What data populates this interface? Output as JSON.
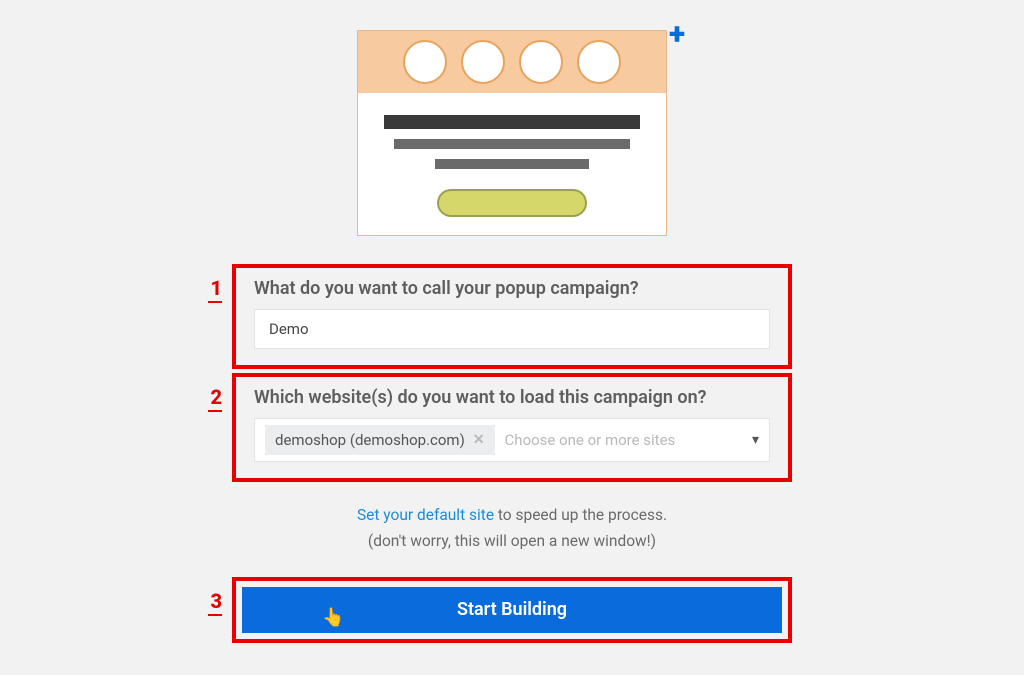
{
  "markers": {
    "one": "1",
    "two": "2",
    "three": "3"
  },
  "question1": {
    "label": "What do you want to call your popup campaign?",
    "value": "Demo"
  },
  "question2": {
    "label": "Which website(s) do you want to load this campaign on?",
    "chip": "demoshop (demoshop.com)",
    "placeholder": "Choose one or more sites"
  },
  "helper": {
    "link": "Set your default site",
    "text_after_link": " to speed up the process.",
    "sub": "(don't worry, this will open a new window!)"
  },
  "cta": {
    "label": "Start Building"
  },
  "icons": {
    "plus": "+",
    "chip_x": "✕",
    "chevron": "▾",
    "cursor": "👆"
  }
}
